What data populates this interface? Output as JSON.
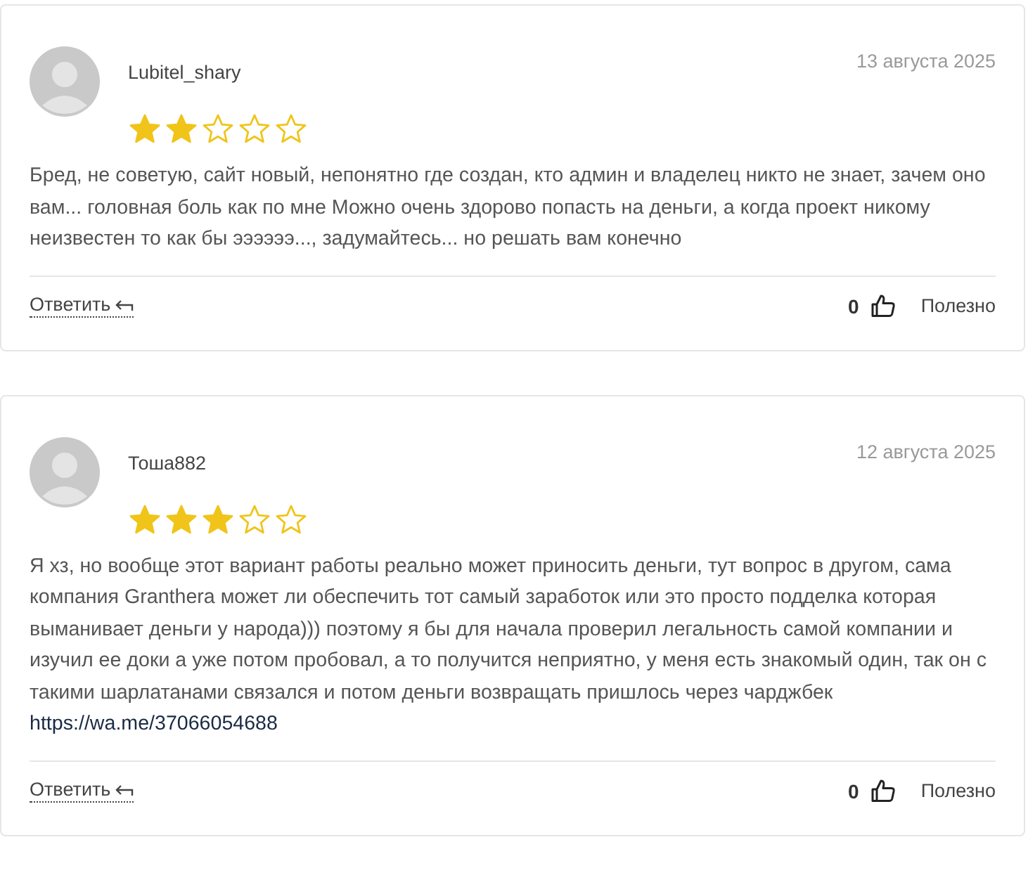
{
  "reviews": [
    {
      "author": "Lubitel_shary",
      "date": "13 августа 2025",
      "stars": 2,
      "text": "Бред, не советую, сайт новый, непонятно где создан, кто админ и владелец никто не знает, зачем оно вам... головная боль как по мне Можно очень здорово попасть на деньги, а когда проект никому неизвестен то как бы ээээээ..., задумайтесь... но решать вам конечно",
      "reply": "Ответить",
      "likes": "0",
      "helpful": "Полезно"
    },
    {
      "author": "Тоша882",
      "date": "12 августа 2025",
      "stars": 3,
      "text": "Я хз, но вообще этот вариант работы реально может приносить деньги, тут вопрос в другом, сама компания Granthera может ли обеспечить тот самый заработок или это просто подделка которая выманивает деньги у народа))) поэтому я бы для начала проверил легальность самой компании и изучил ее доки а уже потом пробовал, а то получится неприятно, у меня есть знакомый один, так он с такими шарлатанами связался и потом деньги возвращать пришлось через чарджбек",
      "link": "https://wa.me/37066054688",
      "reply": "Ответить",
      "likes": "0",
      "helpful": "Полезно"
    }
  ]
}
